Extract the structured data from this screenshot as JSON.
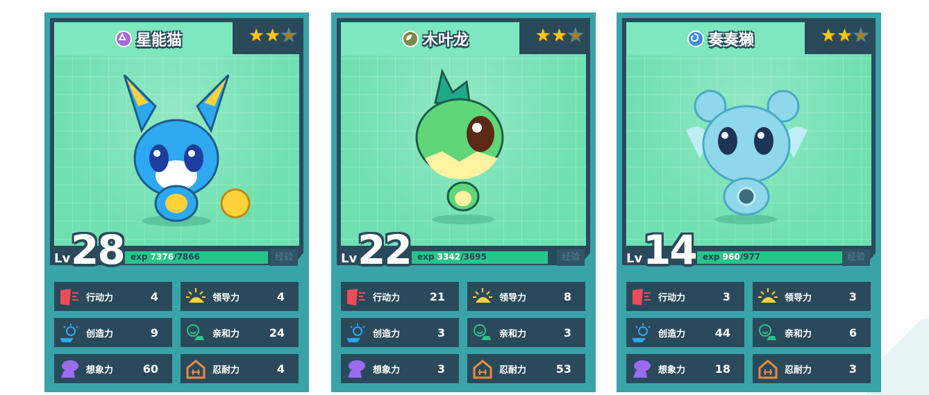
{
  "cards": [
    {
      "name": "星能猫",
      "element_color": "#a46ad8",
      "stars_filled": 2,
      "stars_total": 3,
      "level_label": "Lv",
      "level": "28",
      "exp_label": "exp",
      "exp_current": "7376",
      "exp_max": "/7866",
      "exp_fraction": 0.94,
      "exp_button": "经验",
      "stats": [
        {
          "label": "行动力",
          "value": "4",
          "icon": "action-icon"
        },
        {
          "label": "领导力",
          "value": "4",
          "icon": "leadership-icon"
        },
        {
          "label": "创造力",
          "value": "9",
          "icon": "creativity-icon"
        },
        {
          "label": "亲和力",
          "value": "24",
          "icon": "affinity-icon"
        },
        {
          "label": "想象力",
          "value": "60",
          "icon": "imagination-icon"
        },
        {
          "label": "忍耐力",
          "value": "4",
          "icon": "endurance-icon"
        }
      ]
    },
    {
      "name": "木叶龙",
      "element_color": "#7a8a4a",
      "stars_filled": 2,
      "stars_total": 3,
      "level_label": "Lv",
      "level": "22",
      "exp_label": "exp",
      "exp_current": "3342",
      "exp_max": "/3695",
      "exp_fraction": 0.9,
      "exp_button": "经验",
      "stats": [
        {
          "label": "行动力",
          "value": "21",
          "icon": "action-icon"
        },
        {
          "label": "领导力",
          "value": "8",
          "icon": "leadership-icon"
        },
        {
          "label": "创造力",
          "value": "3",
          "icon": "creativity-icon"
        },
        {
          "label": "亲和力",
          "value": "3",
          "icon": "affinity-icon"
        },
        {
          "label": "想象力",
          "value": "3",
          "icon": "imagination-icon"
        },
        {
          "label": "忍耐力",
          "value": "53",
          "icon": "endurance-icon"
        }
      ]
    },
    {
      "name": "奏奏獭",
      "element_color": "#3a8ee0",
      "stars_filled": 2,
      "stars_total": 3,
      "level_label": "Lv",
      "level": "14",
      "exp_label": "exp",
      "exp_current": "960",
      "exp_max": "/977",
      "exp_fraction": 0.98,
      "exp_button": "经验",
      "stats": [
        {
          "label": "行动力",
          "value": "3",
          "icon": "action-icon"
        },
        {
          "label": "领导力",
          "value": "3",
          "icon": "leadership-icon"
        },
        {
          "label": "创造力",
          "value": "44",
          "icon": "creativity-icon"
        },
        {
          "label": "亲和力",
          "value": "6",
          "icon": "affinity-icon"
        },
        {
          "label": "想象力",
          "value": "18",
          "icon": "imagination-icon"
        },
        {
          "label": "忍耐力",
          "value": "3",
          "icon": "endurance-icon"
        }
      ]
    }
  ]
}
